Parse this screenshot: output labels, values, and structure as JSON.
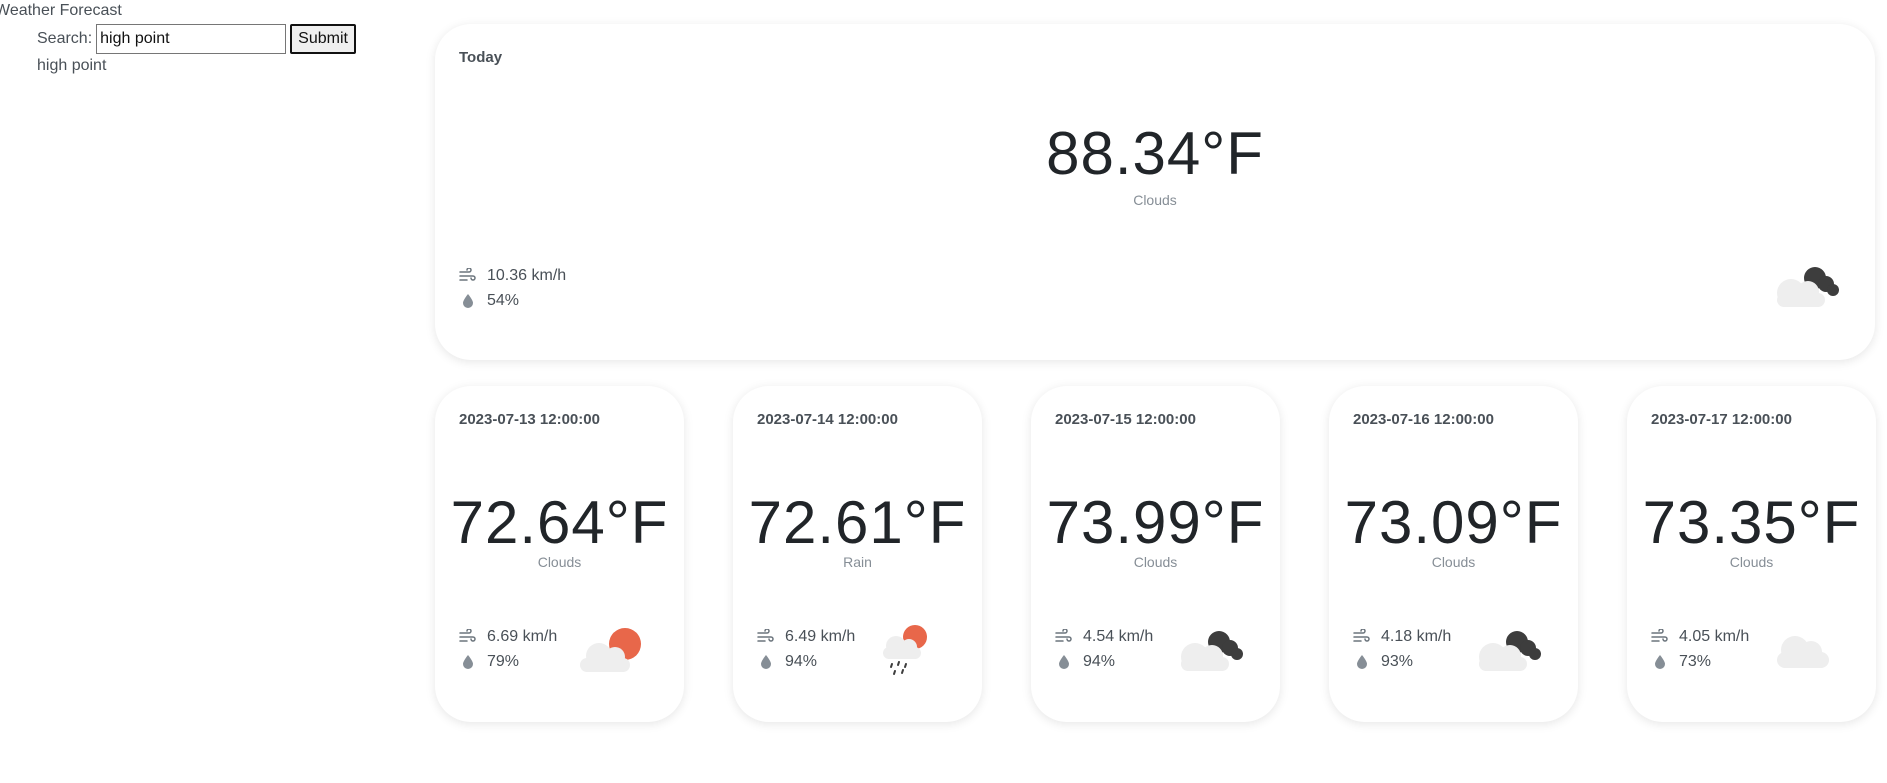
{
  "header": {
    "title": "Weather Forecast",
    "search_label": "Search:",
    "search_value": "high point",
    "submit_label": "Submit",
    "search_echo": "high point"
  },
  "today": {
    "label": "Today",
    "temperature": "88.34°F",
    "condition": "Clouds",
    "wind": "10.36 km/h",
    "humidity": "54%",
    "icon": "dark-clouds-icon"
  },
  "forecast": [
    {
      "date": "2023-07-13 12:00:00",
      "temperature": "72.64°F",
      "condition": "Clouds",
      "wind": "6.69 km/h",
      "humidity": "79%",
      "icon": "sun-cloud-icon"
    },
    {
      "date": "2023-07-14 12:00:00",
      "temperature": "72.61°F",
      "condition": "Rain",
      "wind": "6.49 km/h",
      "humidity": "94%",
      "icon": "sun-rain-icon"
    },
    {
      "date": "2023-07-15 12:00:00",
      "temperature": "73.99°F",
      "condition": "Clouds",
      "wind": "4.54 km/h",
      "humidity": "94%",
      "icon": "dark-clouds-icon"
    },
    {
      "date": "2023-07-16 12:00:00",
      "temperature": "73.09°F",
      "condition": "Clouds",
      "wind": "4.18 km/h",
      "humidity": "93%",
      "icon": "dark-clouds-icon"
    },
    {
      "date": "2023-07-17 12:00:00",
      "temperature": "73.35°F",
      "condition": "Clouds",
      "wind": "4.05 km/h",
      "humidity": "73%",
      "icon": "cloud-icon"
    }
  ],
  "colors": {
    "text": "#495057",
    "temperature": "#212529",
    "muted": "#868e96",
    "sun": "#e8674a",
    "dark_cloud": "#3d3d3d",
    "light_cloud": "#eeeeee"
  }
}
